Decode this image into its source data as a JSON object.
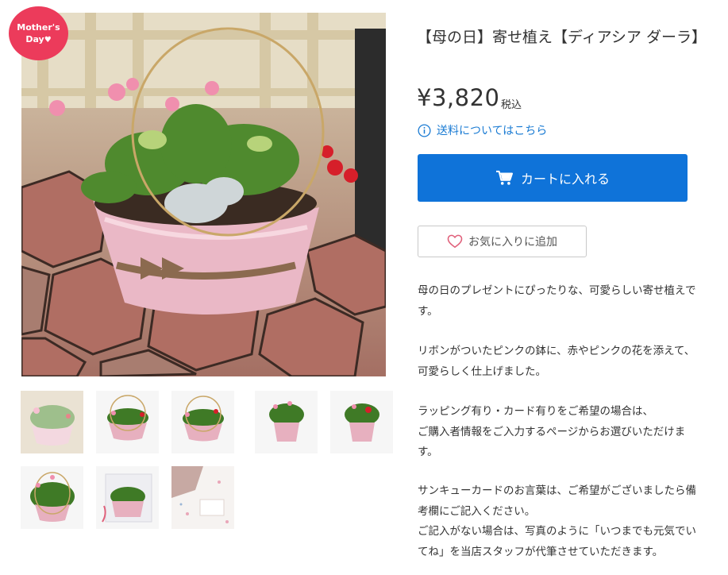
{
  "badge": {
    "line1": "Mother's",
    "line2": "Day",
    "heart": "♥"
  },
  "product": {
    "title": "【母の日】寄せ植え【ディアシア ダーラ】",
    "price": "¥3,820",
    "tax_label": "税込",
    "shipping_link": "送料についてはこちら",
    "cart_button": "カートに入れる",
    "favorite_button": "お気に入りに追加"
  },
  "icons": {
    "info": "info-circle-icon",
    "cart": "cart-icon",
    "heart": "heart-outline-icon"
  },
  "colors": {
    "cart_button": "#0f73d9",
    "link": "#1a7bd3",
    "badge": "#ec3b5b",
    "heart": "#e0607a"
  },
  "description": [
    [
      "母の日のプレゼントにぴったりな、可愛らしい寄せ植えで",
      "す。"
    ],
    [
      "リボンがついたピンクの鉢に、赤やピンクの花を添えて、",
      "可愛らしく仕上げました。"
    ],
    [
      "ラッピング有り・カード有りをご希望の場合は、",
      "ご購入者情報をご入力するページからお選びいただけま",
      "す。"
    ],
    [
      "サンキューカードのお言葉は、ご希望がございましたら備",
      "考欄にご記入ください。",
      "ご記入がない場合は、写真のように「いつまでも元気でい",
      "てね」を当店スタッフが代筆させていただきます。"
    ]
  ],
  "thumbnails": [
    {
      "label": "thumbnail-1",
      "selected": true
    },
    {
      "label": "thumbnail-2",
      "selected": false
    },
    {
      "label": "thumbnail-3",
      "selected": false
    },
    {
      "label": "thumbnail-4",
      "selected": false
    },
    {
      "label": "thumbnail-5",
      "selected": false
    },
    {
      "label": "thumbnail-6",
      "selected": false
    },
    {
      "label": "thumbnail-7",
      "selected": false
    },
    {
      "label": "thumbnail-8",
      "selected": false
    }
  ]
}
